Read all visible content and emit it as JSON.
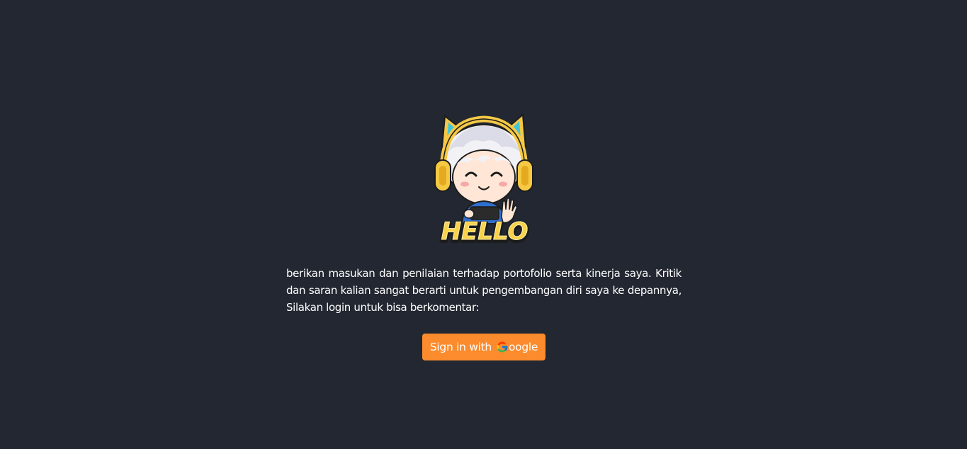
{
  "hero": {
    "image_alt": "HELLO",
    "image_text": "HELLO"
  },
  "message": {
    "text": "berikan masukan dan penilaian terhadap portofolio serta kinerja saya. Kritik dan saran kalian sangat berarti untuk pengembangan diri saya ke depannya, Silakan login untuk bisa berkomentar:"
  },
  "signin": {
    "prefix": "Sign in with",
    "brand_rest": "oogle",
    "icon": "google-g-icon"
  },
  "colors": {
    "background": "#222731",
    "button": "#fb8b2d",
    "text": "#ffffff"
  }
}
